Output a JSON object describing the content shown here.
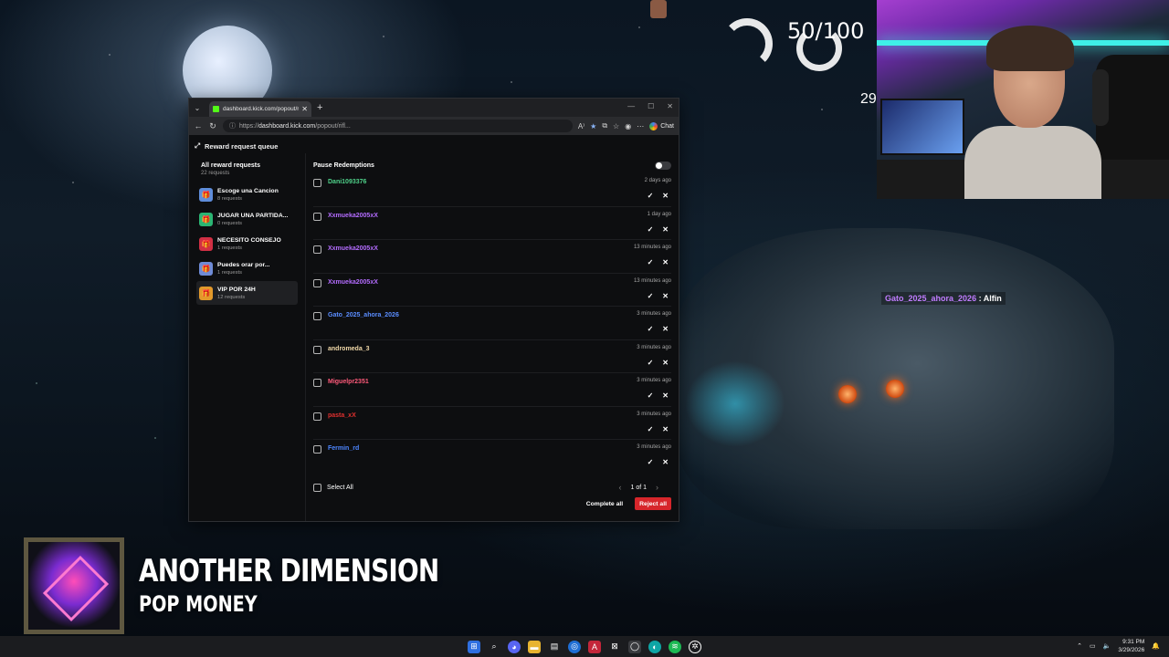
{
  "overlay": {
    "score": "50/100",
    "score_partial": "29",
    "chat_user": "Gato_2025_ahora_2026",
    "chat_message": "Alfin"
  },
  "browser": {
    "tab_title": "dashboard.kick.com/popout/rifle...",
    "url_prefix": "https://",
    "url_host": "dashboard.kick.com",
    "url_path": "/popout/rifl...",
    "chat_label": "Chat"
  },
  "page": {
    "title": "Reward request queue",
    "sidebar": {
      "all_label": "All reward requests",
      "all_count": "22 requests",
      "items": [
        {
          "name": "Escoge una Cancion",
          "count": "8 requests",
          "color": "#5f8ddb"
        },
        {
          "name": "JUGAR UNA PARTIDA...",
          "count": "0 requests",
          "color": "#2bb573"
        },
        {
          "name": "NECESITO CONSEJO",
          "count": "1 requests",
          "color": "#d12f44"
        },
        {
          "name": "Puedes orar por...",
          "count": "1 requests",
          "color": "#6f8bd6"
        },
        {
          "name": "VIP POR 24H",
          "count": "12 requests",
          "color": "#e3992b"
        }
      ]
    },
    "pause_label": "Pause Redemptions",
    "requests": [
      {
        "user": "Dani1093376",
        "time": "2 days ago",
        "color": "#4fd28a"
      },
      {
        "user": "Xxmueka2005xX",
        "time": "1 day ago",
        "color": "#b46cff"
      },
      {
        "user": "Xxmueka2005xX",
        "time": "13 minutes ago",
        "color": "#b46cff"
      },
      {
        "user": "Xxmueka2005xX",
        "time": "13 minutes ago",
        "color": "#b46cff"
      },
      {
        "user": "Gato_2025_ahora_2026",
        "time": "3 minutes ago",
        "color": "#5a8dff"
      },
      {
        "user": "andromeda_3",
        "time": "3 minutes ago",
        "color": "#f0d8a8"
      },
      {
        "user": "Miguelpr2351",
        "time": "3 minutes ago",
        "color": "#ff5a7a"
      },
      {
        "user": "pasta_xX",
        "time": "3 minutes ago",
        "color": "#e0302f"
      },
      {
        "user": "Fermin_rd",
        "time": "3 minutes ago",
        "color": "#4d86ff"
      }
    ],
    "select_all": "Select All",
    "pager": "1 of 1",
    "complete_all": "Complete all",
    "reject_all": "Reject all"
  },
  "now_playing": {
    "title": "ANOTHER DIMENSION",
    "artist": "POP MONEY"
  },
  "taskbar": {
    "time": "9:31 PM",
    "date": "3/29/2026"
  }
}
